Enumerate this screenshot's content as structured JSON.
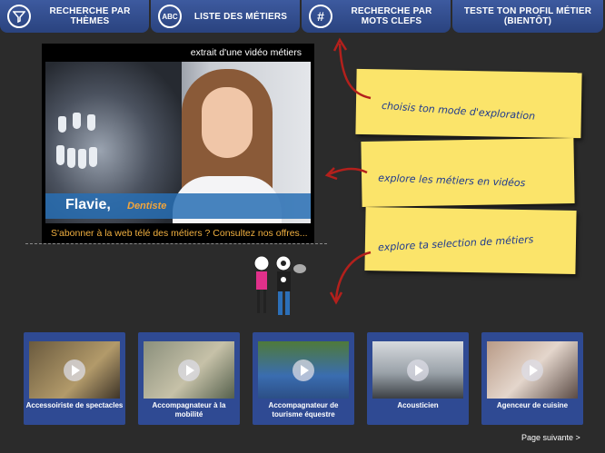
{
  "nav": [
    {
      "label": "RECHERCHE PAR\nTHÈMES",
      "icon": "funnel-icon"
    },
    {
      "label": "LISTE DES MÉTIERS",
      "icon": "abc-icon"
    },
    {
      "label": "RECHERCHE PAR\nMOTS CLEFS",
      "icon": "hash-icon"
    },
    {
      "label": "TESTE TON PROFIL MÉTIER\n(BIENTÔT)",
      "icon": ""
    }
  ],
  "video": {
    "title": "extrait d'une vidéo métiers",
    "name": "Flavie,",
    "job": "Dentiste",
    "subscribe": "S'abonner à la web télé des métiers ? Consultez nos offres..."
  },
  "notes": [
    "choisis ton mode d'exploration",
    "explore les métiers en vidéos",
    "explore ta selection de métiers"
  ],
  "cards": [
    "Accessoiriste de spectacles",
    "Accompagnateur à la mobilité",
    "Accompagnateur de tourisme équestre",
    "Acousticien",
    "Agenceur de cuisine"
  ],
  "pagination": {
    "next": "Page suivante >"
  },
  "colors": {
    "nav": "#2f4a93",
    "note": "#fbe46a",
    "accent": "#f1b040",
    "arrow": "#b3201c"
  }
}
